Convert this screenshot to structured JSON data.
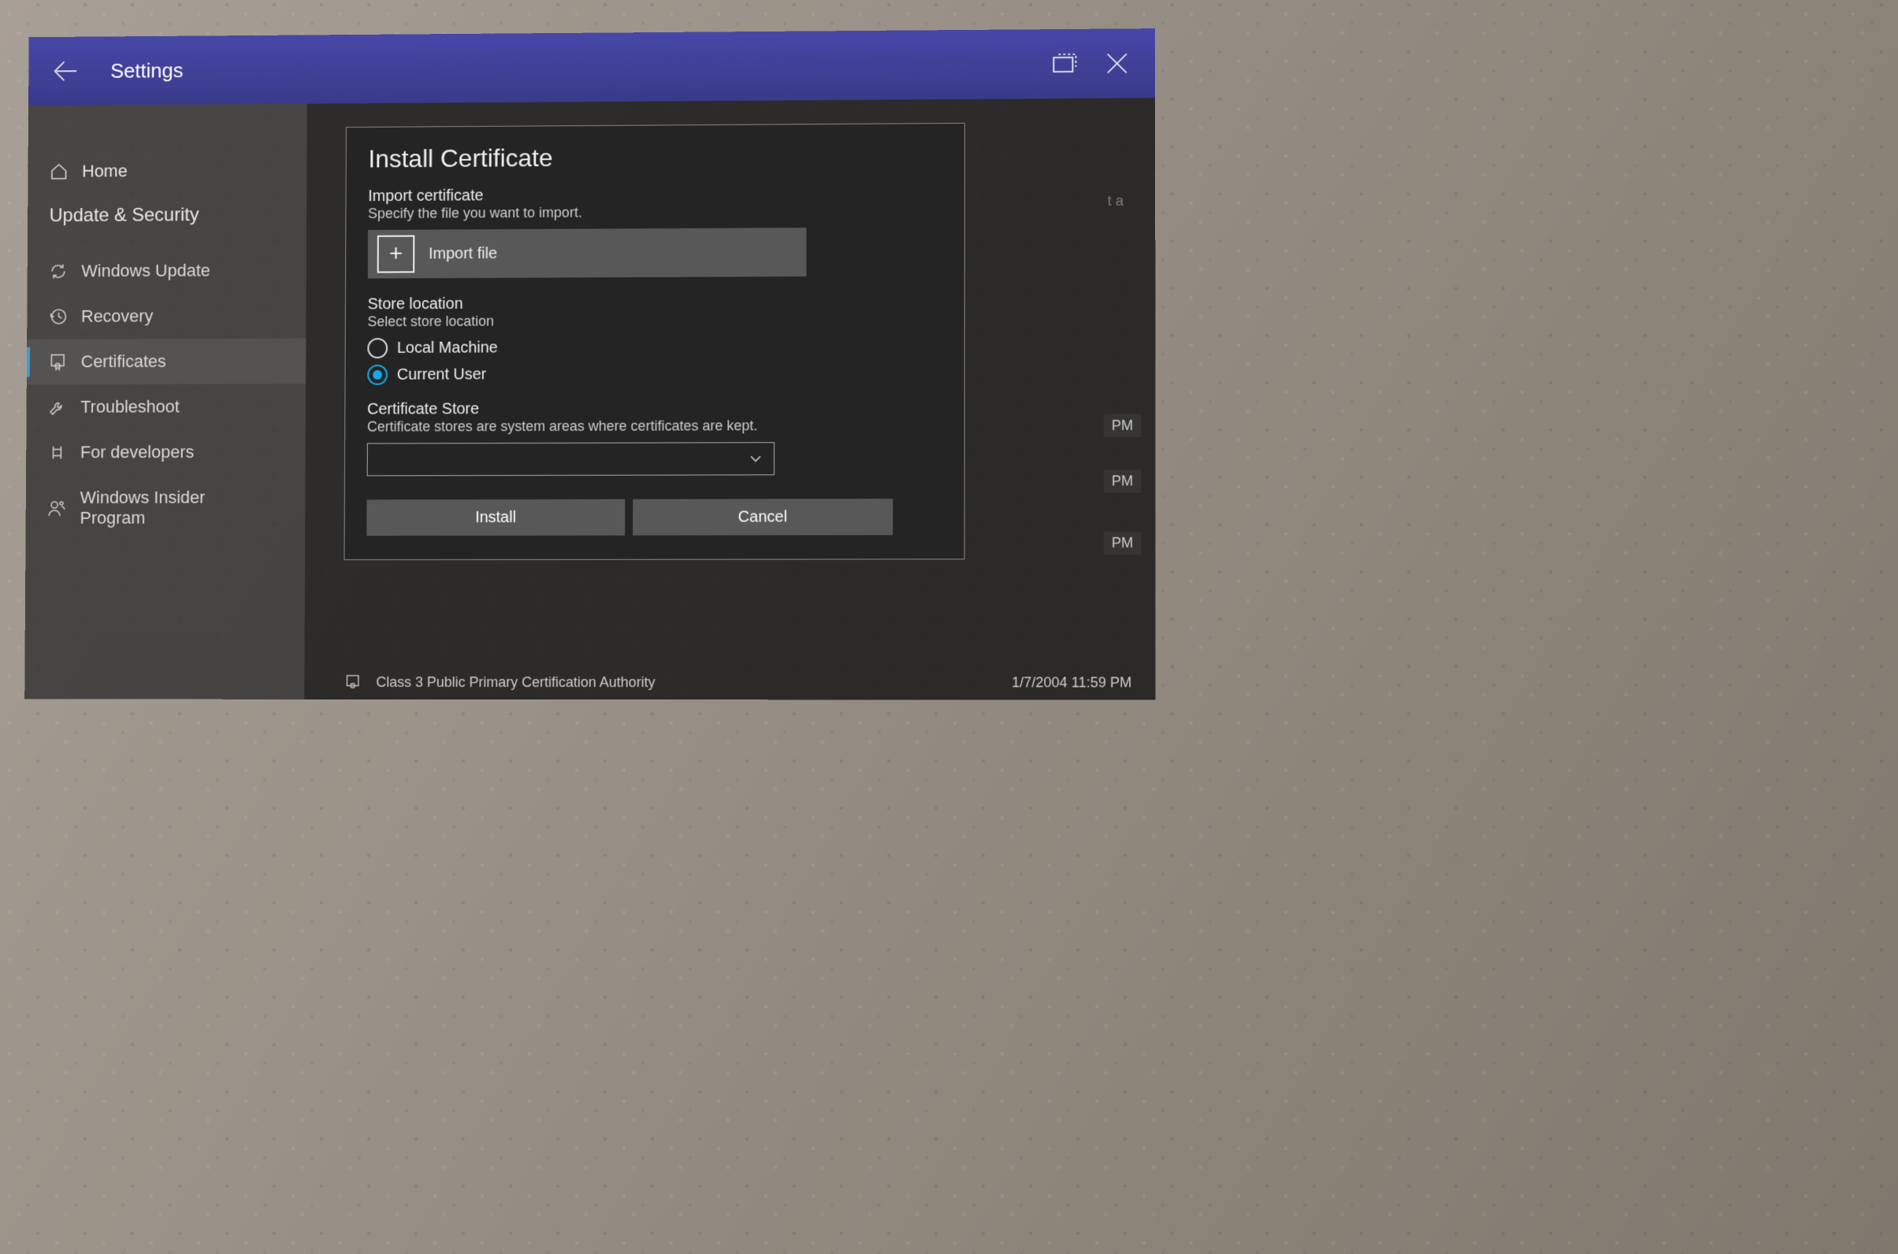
{
  "titlebar": {
    "title": "Settings"
  },
  "sidebar": {
    "home": "Home",
    "section": "Update & Security",
    "items": [
      {
        "icon": "sync-icon",
        "label": "Windows Update"
      },
      {
        "icon": "history-icon",
        "label": "Recovery"
      },
      {
        "icon": "certificate-icon",
        "label": "Certificates"
      },
      {
        "icon": "wrench-icon",
        "label": "Troubleshoot"
      },
      {
        "icon": "dev-icon",
        "label": "For developers"
      },
      {
        "icon": "insider-icon",
        "label": "Windows Insider Program"
      }
    ],
    "active_index": 2
  },
  "dialog": {
    "title": "Install Certificate",
    "import_section": {
      "heading": "Import certificate",
      "subtext": "Specify the file you want to import.",
      "button_label": "Import file"
    },
    "store_location": {
      "heading": "Store location",
      "subtext": "Select store location",
      "options": [
        {
          "label": "Local Machine",
          "selected": false
        },
        {
          "label": "Current User",
          "selected": true
        }
      ]
    },
    "certificate_store": {
      "heading": "Certificate Store",
      "subtext": "Certificate stores are system areas where certificates are kept.",
      "selected": ""
    },
    "install_label": "Install",
    "cancel_label": "Cancel"
  },
  "behind": {
    "partial_text": "t a",
    "pm_badge": "PM",
    "footer_name": "Class 3 Public Primary Certification Authority",
    "footer_date": "1/7/2004 11:59 PM"
  }
}
